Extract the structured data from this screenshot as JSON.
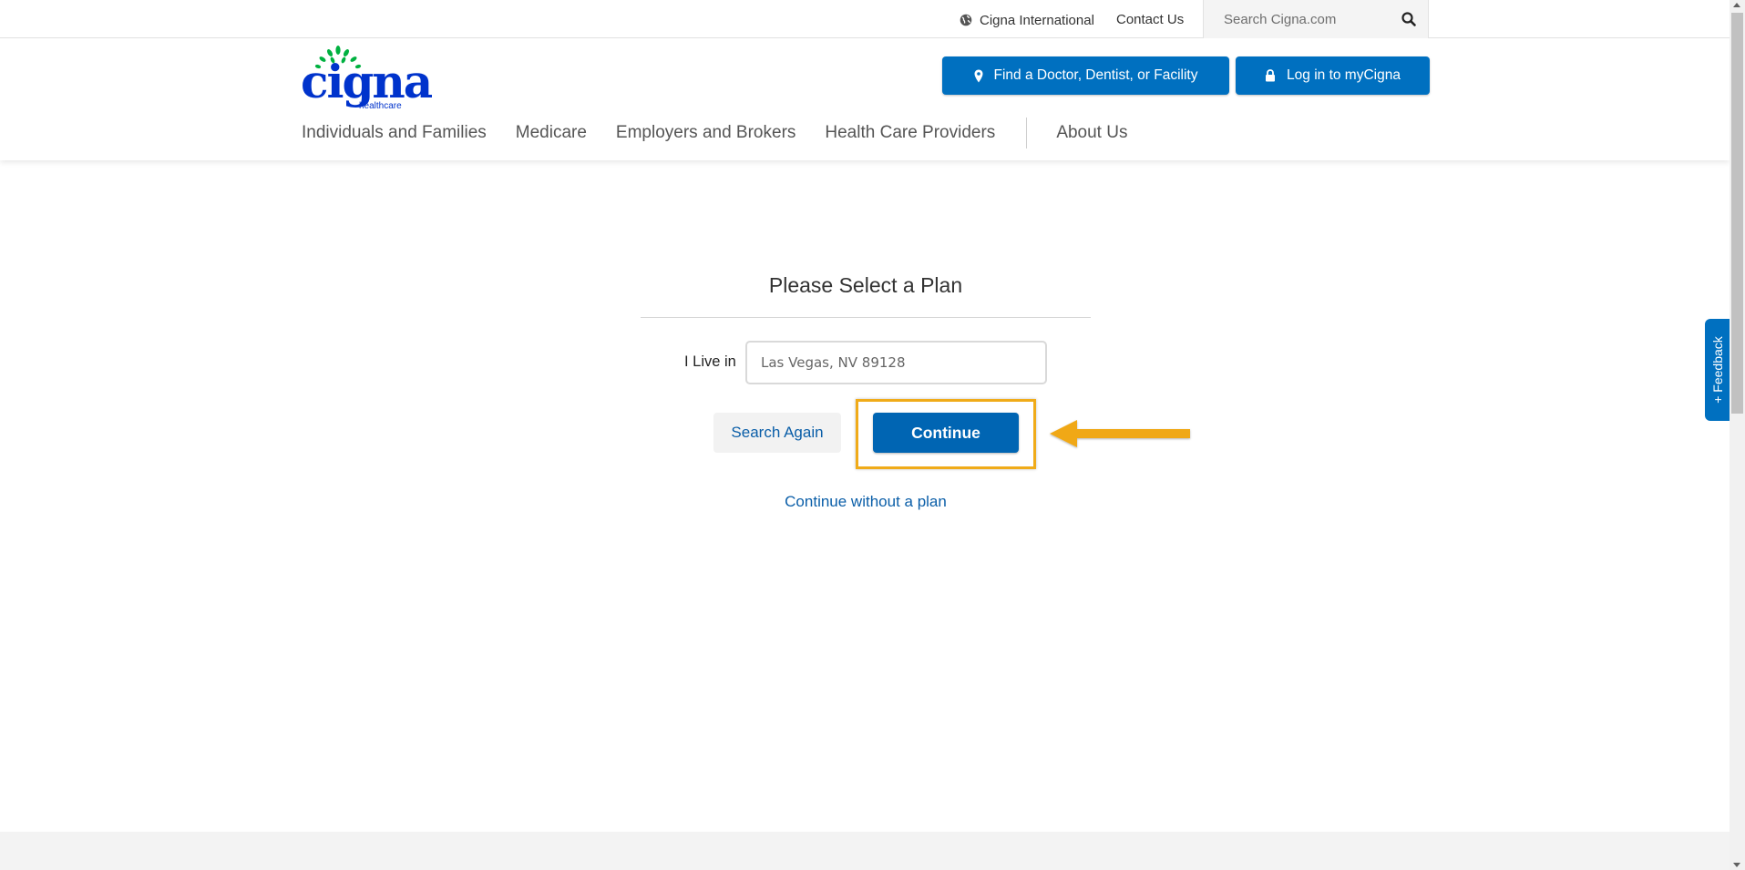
{
  "utility": {
    "international_label": "Cigna International",
    "contact_label": "Contact Us",
    "search_placeholder": "Search Cigna.com"
  },
  "logo": {
    "wordmark": "cigna",
    "sub": "healthcare"
  },
  "header": {
    "find_button": "Find a Doctor, Dentist, or Facility",
    "login_button": "Log in to myCigna"
  },
  "nav": {
    "items": [
      "Individuals and Families",
      "Medicare",
      "Employers and Brokers",
      "Health Care Providers",
      "About Us"
    ]
  },
  "plan": {
    "title": "Please Select a Plan",
    "live_label": "I Live in",
    "location_placeholder": "Las Vegas, NV 89128",
    "search_again": "Search Again",
    "continue": "Continue",
    "continue_without": "Continue without a plan"
  },
  "feedback": {
    "label": "+ Feedback"
  },
  "colors": {
    "primary": "#0070c0",
    "logo_blue": "#0033cc",
    "logo_green": "#00b140",
    "highlight": "#f0ab19"
  },
  "icons": [
    "globe-icon",
    "search-icon",
    "map-pin-icon",
    "lock-icon",
    "arrow-left-icon"
  ]
}
